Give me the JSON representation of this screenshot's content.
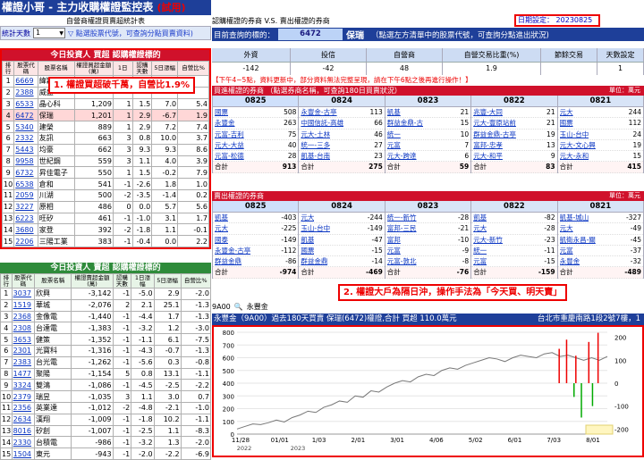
{
  "app": {
    "title": "權證小哥 - 主力收購權證監控表",
    "trial": "(試用)"
  },
  "left": {
    "subtitle": "自營商權證買賣超統計表",
    "stat_label": "統計天數",
    "days_value": "1",
    "hint": "點選股票代號，可查詢分點買賣資料)",
    "buy": {
      "title": "今日投資人 買超 認購權證標的",
      "headers": [
        "排行",
        "股票代碼",
        "股票名稱",
        "權證買超金額(萬)",
        "認購天數",
        "5日漲幅",
        "自營比%"
      ],
      "rows": [
        [
          "1",
          "6669",
          "緯穎",
          "",
          "",
          "",
          ""
        ],
        [
          "2",
          "2388",
          "威盛",
          "",
          "",
          "",
          ""
        ],
        [
          "3",
          "6533",
          "晶心科",
          "1,209",
          "1",
          "1.5",
          "7.0",
          "5.4"
        ],
        [
          "4",
          "6472",
          "保瑞",
          "1,201",
          "1",
          "2.9",
          "-6.7",
          "1.9"
        ],
        [
          "5",
          "5340",
          "建榮",
          "889",
          "1",
          "2.9",
          "7.2",
          "7.4"
        ],
        [
          "6",
          "2332",
          "友訊",
          "663",
          "3",
          "0.8",
          "10.0",
          "3.7"
        ],
        [
          "7",
          "5443",
          "均豪",
          "662",
          "3",
          "9.3",
          "9.3",
          "8.6"
        ],
        [
          "8",
          "9958",
          "世紀鋼",
          "559",
          "3",
          "1.1",
          "4.0",
          "3.9"
        ],
        [
          "9",
          "6732",
          "昇佳電子",
          "550",
          "1",
          "1.5",
          "-0.2",
          "7.9"
        ],
        [
          "10",
          "6538",
          "倉和",
          "541",
          "-1",
          "-2.6",
          "1.8",
          "1.0"
        ],
        [
          "11",
          "2059",
          "川湖",
          "500",
          "-2",
          "-3.5",
          "-1.4",
          "0.2"
        ],
        [
          "12",
          "3227",
          "原相",
          "486",
          "0",
          "0.0",
          "5.7",
          "5.6"
        ],
        [
          "13",
          "6223",
          "旺矽",
          "461",
          "-1",
          "-1.0",
          "3.1",
          "1.7"
        ],
        [
          "14",
          "3680",
          "家登",
          "392",
          "-2",
          "-1.8",
          "1.1",
          "-0.1"
        ],
        [
          "15",
          "2206",
          "三陽工業",
          "383",
          "-1",
          "-0.4",
          "0.0",
          "2.2"
        ]
      ]
    },
    "sell": {
      "title": "今日投資人 賣超 認購權證標的",
      "headers": [
        "排行",
        "股票代碼",
        "股票名稱",
        "權證賣超金額(萬)",
        "認購天數",
        "1日漲幅",
        "5日漲幅",
        "自營比%"
      ],
      "rows": [
        [
          "1",
          "3037",
          "欣興",
          "-3,142",
          "-1",
          "-5.0",
          "2.9",
          "-2.0"
        ],
        [
          "2",
          "1519",
          "華城",
          "-2,076",
          "2",
          "2.1",
          "25.1",
          "-1.3"
        ],
        [
          "3",
          "2368",
          "金像電",
          "-1,440",
          "-1",
          "-4.4",
          "1.7",
          "-1.3"
        ],
        [
          "4",
          "2308",
          "台達電",
          "-1,383",
          "-1",
          "-3.2",
          "1.2",
          "-3.0"
        ],
        [
          "5",
          "3653",
          "健策",
          "-1,352",
          "-1",
          "-1.1",
          "6.1",
          "-7.5"
        ],
        [
          "6",
          "2301",
          "光寶科",
          "-1,316",
          "-1",
          "-4.3",
          "-0.7",
          "-1.3"
        ],
        [
          "7",
          "2383",
          "台光電",
          "-1,262",
          "-1",
          "-5.6",
          "0.3",
          "-0.8"
        ],
        [
          "8",
          "1477",
          "聚陽",
          "-1,154",
          "5",
          "0.8",
          "13.1",
          "-1.1"
        ],
        [
          "9",
          "3324",
          "雙鴻",
          "-1,086",
          "-1",
          "-4.5",
          "-2.5",
          "-2.2"
        ],
        [
          "10",
          "2379",
          "瑞昱",
          "-1,035",
          "3",
          "1.1",
          "3.0",
          "0.7"
        ],
        [
          "11",
          "2356",
          "英業達",
          "-1,012",
          "-2",
          "-4.8",
          "-2.1",
          "-1.0"
        ],
        [
          "12",
          "2634",
          "漢翔",
          "-1,009",
          "-1",
          "-1.8",
          "10.2",
          "-1.1"
        ],
        [
          "13",
          "8016",
          "矽創",
          "-1,007",
          "-1",
          "-2.5",
          "1.1",
          "-8.3"
        ],
        [
          "14",
          "2330",
          "台積電",
          "-986",
          "-1",
          "-3.2",
          "1.3",
          "-2.0"
        ],
        [
          "15",
          "1504",
          "東元",
          "-943",
          "-1",
          "-2.0",
          "-2.2",
          "-6.9"
        ]
      ]
    }
  },
  "right": {
    "subtitle": "認購權證的券商 V.S. 賣出權證的券商",
    "date_label": "日期設定",
    "date_value": "20230825",
    "query_label": "目前查詢的標的：",
    "query_code": "6472",
    "query_name": "保瑞",
    "query_hint": "（點選左方清單中的股票代號，可查詢分點進出狀況)",
    "stat_headers": [
      "外資",
      "投信",
      "自營商",
      "自營交易比重(%)",
      "節餘交易",
      "天數設定"
    ],
    "stat_values": [
      "-142",
      "-42",
      "48",
      "1.9",
      "",
      "1"
    ],
    "notice": "【下午4~5點，資料更新中，部分資料無法完整呈現，請在下午6點之後再進行操作！】",
    "buy_panel": {
      "title": "買進權證的券商",
      "note": "（點選券商名稱，可查詢180日買賣狀況）",
      "unit": "單位：萬元",
      "dates": [
        "0825",
        "0824",
        "0823",
        "0822",
        "0821"
      ],
      "cols": [
        [
          [
            "國票",
            "508"
          ],
          [
            "永豐金",
            "263"
          ],
          [
            "元富-吉利",
            "75"
          ],
          [
            "元大-大益",
            "40"
          ],
          [
            "元富-松德",
            "28"
          ],
          [
            "合計",
            "913"
          ]
        ],
        [
          [
            "永豐金-古亭",
            "113"
          ],
          [
            "中國信託-高雄",
            "66"
          ],
          [
            "元大-土林",
            "46"
          ],
          [
            "統一-三多",
            "27"
          ],
          [
            "凱基-台南",
            "23"
          ],
          [
            "合計",
            "275"
          ]
        ],
        [
          [
            "凱基",
            "21"
          ],
          [
            "群益金鼎-古",
            "15"
          ],
          [
            "統一",
            "10"
          ],
          [
            "元富",
            "7"
          ],
          [
            "元大-跨達",
            "6"
          ],
          [
            "合計",
            "59"
          ]
        ],
        [
          [
            "兆豐-大同",
            "21"
          ],
          [
            "元大-豐原站前",
            "21"
          ],
          [
            "群益金鼎-古亭",
            "19"
          ],
          [
            "富邦-忠孝",
            "13"
          ],
          [
            "元大-和平",
            "9"
          ],
          [
            "合計",
            "83"
          ]
        ],
        [
          [
            "元大",
            "244"
          ],
          [
            "國票",
            "112"
          ],
          [
            "玉山-台中",
            "24"
          ],
          [
            "元大-文心興",
            "19"
          ],
          [
            "元大-永和",
            "15"
          ],
          [
            "合計",
            "415"
          ]
        ]
      ]
    },
    "sell_panel": {
      "title": "賣出權證的券商",
      "unit": "單位：萬元",
      "dates": [
        "0825",
        "0824",
        "0823",
        "0822",
        "0821"
      ],
      "cols": [
        [
          [
            "凱基",
            "-403"
          ],
          [
            "元大",
            "-225"
          ],
          [
            "國泰",
            "-149"
          ],
          [
            "永豐金-古亭",
            "-112"
          ],
          [
            "群益金鼎",
            "-86"
          ],
          [
            "合計",
            "-974"
          ]
        ],
        [
          [
            "元大",
            "-244"
          ],
          [
            "玉山-台中",
            "-149"
          ],
          [
            "凱基",
            "-47"
          ],
          [
            "國票",
            "-15"
          ],
          [
            "群益金鼎",
            "-14"
          ],
          [
            "合計",
            "-469"
          ]
        ],
        [
          [
            "統一-新竹",
            "-28"
          ],
          [
            "富邦-三民",
            "-21"
          ],
          [
            "富邦",
            "-10"
          ],
          [
            "元富",
            "-9"
          ],
          [
            "元富-敦北",
            "-8"
          ],
          [
            "合計",
            "-76"
          ]
        ],
        [
          [
            "凱基",
            "-82"
          ],
          [
            "元大",
            "-28"
          ],
          [
            "元大-新竹",
            "-23"
          ],
          [
            "統一",
            "-11"
          ],
          [
            "元富",
            "-15"
          ],
          [
            "合計",
            "-159"
          ]
        ],
        [
          [
            "凱基-城山",
            "-327"
          ],
          [
            "元大",
            "-49"
          ],
          [
            "凱衛永昌-關",
            "-45"
          ],
          [
            "元富",
            "-37"
          ],
          [
            "永豐金",
            "-32"
          ],
          [
            "合計",
            "-489"
          ]
        ]
      ]
    },
    "callout1": "1. 權證買超破千萬，自營比1.9%",
    "callout2": "2. 權證大戶為隔日沖，操作手法為「今天買、明天賣」",
    "search_code": "9A00",
    "search_name": "永豐金",
    "chart_title": "永豐金（9A00）過去180天買賣 保瑞(6472)權證,合計 買超 110.0萬元",
    "chart_address": "台北市重慶南路1段2號7樓，1"
  },
  "chart_data": {
    "type": "line",
    "title": "永豐金（9A00）過去180天買賣 保瑞(6472)權證,合計 買超 110.0萬元",
    "x_ticks": [
      "11/28",
      "01/01",
      "1/03",
      "2/01",
      "3/01",
      "4/06",
      "5/02",
      "6/01",
      "7/03",
      "8/01"
    ],
    "x_year_labels": [
      "2022",
      "2023"
    ],
    "y_left": [
      0,
      100,
      200,
      300,
      400,
      500,
      600,
      700,
      800
    ],
    "y_right": [
      -200,
      -100,
      0,
      100,
      200
    ],
    "series": [
      {
        "values": [
          40,
          60,
          80,
          75,
          90,
          110,
          95,
          130,
          150,
          180,
          170,
          210,
          230,
          260,
          250,
          300,
          290,
          340,
          330,
          370,
          400,
          420,
          410,
          450,
          470,
          460,
          500,
          520,
          510,
          540,
          560,
          580,
          600,
          590,
          570,
          600,
          620,
          610,
          600,
          630,
          640,
          610,
          620,
          600,
          580,
          600,
          580,
          610
        ]
      }
    ],
    "bars": [
      {
        "x": 0.87,
        "v": 150
      },
      {
        "x": 0.89,
        "v": 190
      },
      {
        "x": 0.91,
        "v": -60
      },
      {
        "x": 0.915,
        "v": 120
      },
      {
        "x": 0.93,
        "v": -150
      },
      {
        "x": 0.95,
        "v": 180
      },
      {
        "x": 0.96,
        "v": -100
      },
      {
        "x": 0.975,
        "v": 220
      }
    ]
  },
  "colors": {
    "header_blue": "#1e3f99",
    "red": "#d0112b",
    "green": "#2e8b3a",
    "link": "#0b36c2"
  }
}
